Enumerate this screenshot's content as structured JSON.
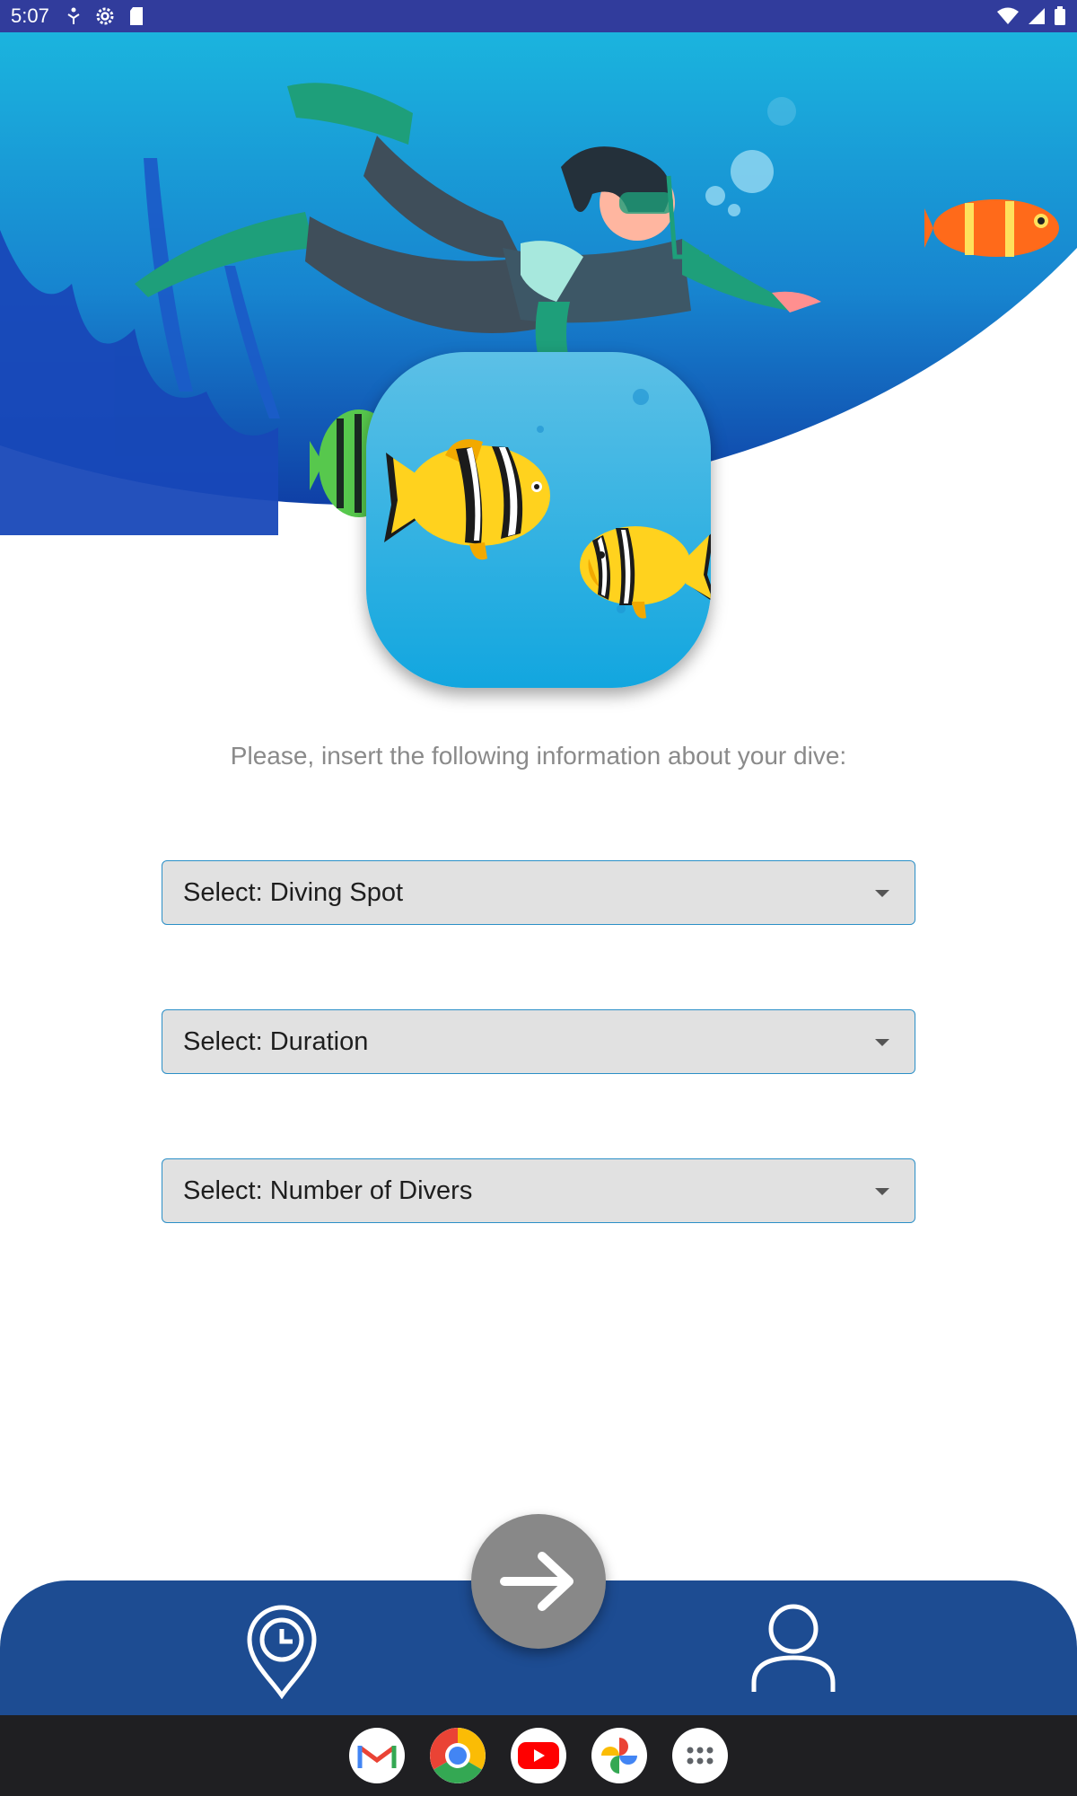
{
  "status_bar": {
    "time": "5:07",
    "left_icons": [
      "accessibility-icon",
      "settings-icon",
      "sd-card-icon"
    ],
    "right_icons": [
      "wifi-icon",
      "signal-icon",
      "battery-icon"
    ]
  },
  "form": {
    "instruction": "Please, insert the following information about your dive:",
    "dropdowns": [
      {
        "label": "Select: Diving Spot"
      },
      {
        "label": "Select: Duration"
      },
      {
        "label": "Select: Number of Divers"
      }
    ]
  },
  "bottom_nav": {
    "left_icon": "location-history-icon",
    "center_icon": "arrow-right-icon",
    "right_icon": "profile-icon"
  },
  "dock": {
    "apps": [
      "gmail-icon",
      "chrome-icon",
      "youtube-icon",
      "photos-icon",
      "app-drawer-icon"
    ]
  },
  "colors": {
    "status_bar": "#313c9c",
    "ocean": "#1ab3dd",
    "nav": "#1d4c92",
    "fab": "#888888",
    "dropdown_border": "#2b8fc7"
  }
}
